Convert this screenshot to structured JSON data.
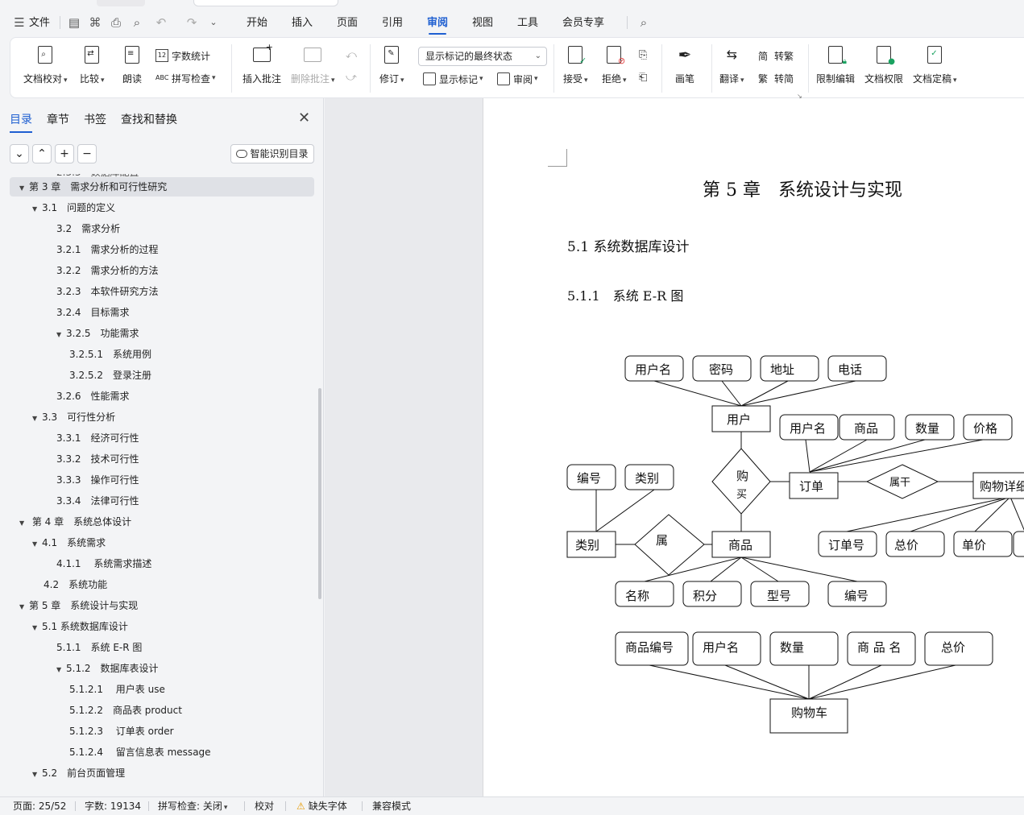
{
  "menubar": {
    "file_label": "文件",
    "tabs": [
      {
        "label": "开始",
        "active": false
      },
      {
        "label": "插入",
        "active": false
      },
      {
        "label": "页面",
        "active": false
      },
      {
        "label": "引用",
        "active": false
      },
      {
        "label": "审阅",
        "active": true
      },
      {
        "label": "视图",
        "active": false
      },
      {
        "label": "工具",
        "active": false
      },
      {
        "label": "会员专享",
        "active": false
      }
    ]
  },
  "ribbon": {
    "proofread": "文档校对",
    "compare": "比较",
    "read_aloud": "朗读",
    "word_count": "字数统计",
    "spell_check": "拼写检查",
    "insert_comment": "插入批注",
    "delete_comment": "删除批注",
    "track_changes": "修订",
    "markup_state": "显示标记的最终状态",
    "show_markup": "显示标记",
    "review": "审阅",
    "accept": "接受",
    "reject": "拒绝",
    "pen": "画笔",
    "translate": "翻译",
    "to_traditional": "转繁",
    "to_simplified": "转简",
    "restrict_edit": "限制编辑",
    "doc_permission": "文档权限",
    "doc_finalize": "文档定稿"
  },
  "navpanel": {
    "tabs": [
      "目录",
      "章节",
      "书签",
      "查找和替换"
    ],
    "smart_toc": "智能识别目录",
    "toc": [
      {
        "level": 1,
        "text": "第 3 章　需求分析和可行性研究",
        "expanded": true,
        "selected": true
      },
      {
        "level": 2,
        "text": "3.1　问题的定义",
        "expanded": true
      },
      {
        "level": 3,
        "text": "3.2　需求分析"
      },
      {
        "level": 3,
        "text": "3.2.1　需求分析的过程"
      },
      {
        "level": 3,
        "text": "3.2.2　需求分析的方法"
      },
      {
        "level": 3,
        "text": "3.2.3　本软件研究方法"
      },
      {
        "level": 3,
        "text": "3.2.4　目标需求"
      },
      {
        "level": 3,
        "text": "3.2.5　功能需求",
        "expanded": true
      },
      {
        "level": 4,
        "text": "3.2.5.1　系统用例"
      },
      {
        "level": 4,
        "text": "3.2.5.2　登录注册"
      },
      {
        "level": 3,
        "text": "3.2.6　性能需求"
      },
      {
        "level": 2,
        "text": "3.3　可行性分析",
        "expanded": true
      },
      {
        "level": 3,
        "text": "3.3.1　经济可行性"
      },
      {
        "level": 3,
        "text": "3.3.2　技术可行性"
      },
      {
        "level": 3,
        "text": "3.3.3　操作可行性"
      },
      {
        "level": 3,
        "text": "3.3.4　法律可行性"
      },
      {
        "level": 1,
        "text": " 第 4 章　系统总体设计",
        "expanded": true
      },
      {
        "level": 2,
        "text": "4.1　系统需求",
        "expanded": true
      },
      {
        "level": 3,
        "text": "4.1.1　 系统需求描述"
      },
      {
        "level": 2,
        "text": "4.2　系统功能",
        "noarrow": true
      },
      {
        "level": 1,
        "text": "第 5 章　系统设计与实现",
        "expanded": true
      },
      {
        "level": 2,
        "text": "5.1  系统数据库设计",
        "expanded": true
      },
      {
        "level": 3,
        "text": "5.1.1　系统 E-R 图"
      },
      {
        "level": 3,
        "text": "5.1.2　数据库表设计",
        "expanded": true
      },
      {
        "level": 4,
        "text": "5.1.2.1　 用户表 use"
      },
      {
        "level": 4,
        "text": "5.1.2.2　商品表 product"
      },
      {
        "level": 4,
        "text": "5.1.2.3　 订单表 order"
      },
      {
        "level": 4,
        "text": "5.1.2.4　 留言信息表 message"
      },
      {
        "level": 2,
        "text": "5.2　前台页面管理",
        "expanded": true
      }
    ]
  },
  "document": {
    "chapter_title": "第 5 章　系统设计与实现",
    "section": "5.1  系统数据库设计",
    "subsection": "5.1.1　系统 E-R 图",
    "er": {
      "user_attrs": [
        "用户名",
        "密码",
        "地址",
        "电话"
      ],
      "user": "用户",
      "order_attrs": [
        "用户名",
        "商品",
        "数量",
        "价格"
      ],
      "buy": "购",
      "buy2": "买",
      "order": "订单",
      "contains": "属干",
      "cart_detail": "购物详细",
      "id": "编号",
      "category": "类别",
      "category_entity": "类别",
      "belongs": "属",
      "product": "商品",
      "detail_attrs": [
        "订单号",
        "总价",
        "单价"
      ],
      "product_attrs": [
        "名称",
        "积分",
        "型号",
        "编号"
      ],
      "cart_attrs": [
        "商品编号",
        "用户名",
        "数量",
        "商 品 名",
        "总价"
      ],
      "cart": "购物车"
    }
  },
  "statusbar": {
    "page": "页面: 25/52",
    "words": "字数: 19134",
    "spell": "拼写检查: 关闭",
    "proof": "校对",
    "missing_font": "缺失字体",
    "compat": "兼容模式"
  }
}
